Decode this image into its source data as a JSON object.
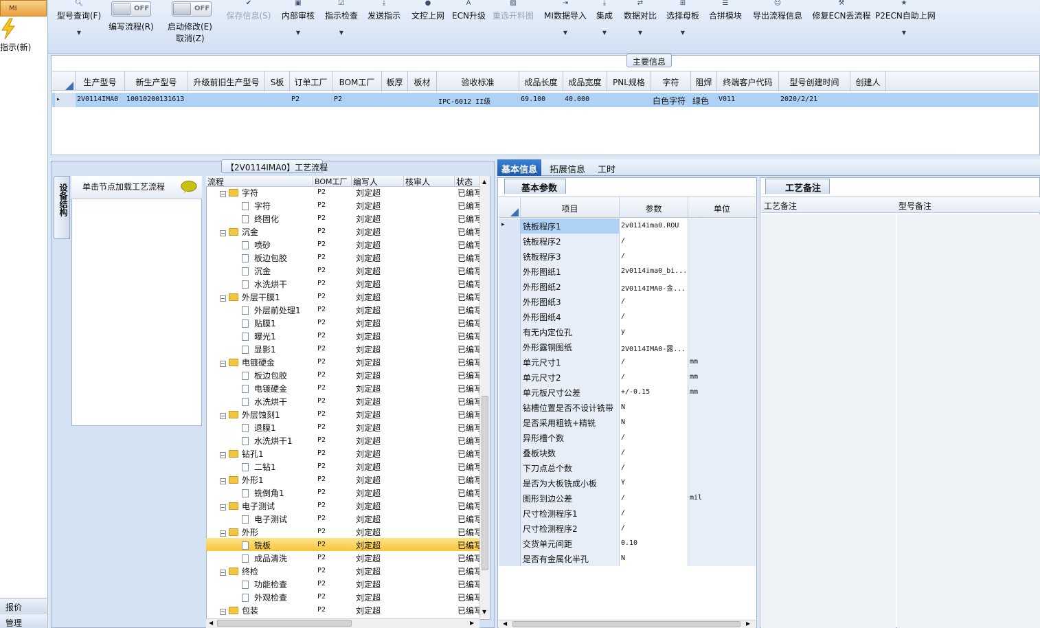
{
  "left_nav": {
    "module_tab": "MI",
    "current_item": "指示(新)",
    "bottom_items": [
      "报价",
      "管理"
    ]
  },
  "toolbar": {
    "query": "型号查询(F)",
    "edit_flow_toggle": "OFF",
    "edit_flow": "编写流程(R)",
    "start_modify_toggle": "OFF",
    "start_modify": "启动修改(E)",
    "cancel": "取消(Z)",
    "save_info": "保存信息(S)",
    "internal_audit": "内部审核",
    "instruction_check": "指示检查",
    "send_instruction": "发送指示",
    "doc_control_online": "文控上网",
    "ecn_upgrade": "ECN升级",
    "reselect_cut_chart": "重选开料图",
    "mi_import": "MI数据导入",
    "integrate": "集成",
    "data_compare": "数据对比",
    "select_mother_board": "选择母板",
    "merge_module": "合拼模块",
    "export_flow": "导出流程信息",
    "repair_ecn_flow": "修复ECN丢流程",
    "p2ecn_online": "P2ECN自助上网"
  },
  "main_info": {
    "title": "主要信息",
    "columns": [
      "生产型号",
      "新生产型号",
      "升级前旧生产型号",
      "S板",
      "订单工厂",
      "BOM工厂",
      "板厚",
      "板材",
      "验收标准",
      "成品长度",
      "成品宽度",
      "PNL规格",
      "字符",
      "阻焊",
      "终端客户代码",
      "型号创建时间",
      "创建人"
    ],
    "row": {
      "prod_model": "2V0114IMA0",
      "new_model": "10010200131613",
      "old_model": "",
      "s_board": "",
      "order_factory": "P2",
      "bom_factory": "P2",
      "thickness": "",
      "material": "",
      "standard": "IPC-6012 II级",
      "length": "69.100",
      "width": "40.000",
      "pnl": "",
      "silkscreen": "白色字符",
      "solder_mask": "绿色",
      "customer_code": "V011",
      "created": "2020/2/21",
      "creator": ""
    }
  },
  "process": {
    "title": "【2V0114IMA0】工艺流程",
    "side_tab": "设备结构",
    "node_hint": "单击节点加载工艺流程",
    "columns": [
      "流程",
      "BOM工厂",
      "编写人",
      "核审人",
      "状态"
    ],
    "rows": [
      {
        "name": "字符",
        "level": 0,
        "factory": "P2",
        "writer": "刘定超",
        "status": "已编写"
      },
      {
        "name": "字符",
        "level": 1,
        "factory": "P2",
        "writer": "刘定超",
        "status": "已编写"
      },
      {
        "name": "终固化",
        "level": 1,
        "factory": "P2",
        "writer": "刘定超",
        "status": "已编写"
      },
      {
        "name": "沉金",
        "level": 0,
        "factory": "P2",
        "writer": "刘定超",
        "status": "已编写"
      },
      {
        "name": "喷砂",
        "level": 1,
        "factory": "P2",
        "writer": "刘定超",
        "status": "已编写"
      },
      {
        "name": "板边包胶",
        "level": 1,
        "factory": "P2",
        "writer": "刘定超",
        "status": "已编写"
      },
      {
        "name": "沉金",
        "level": 1,
        "factory": "P2",
        "writer": "刘定超",
        "status": "已编写"
      },
      {
        "name": "水洗烘干",
        "level": 1,
        "factory": "P2",
        "writer": "刘定超",
        "status": "已编写"
      },
      {
        "name": "外层干膜1",
        "level": 0,
        "factory": "P2",
        "writer": "刘定超",
        "status": "已编写"
      },
      {
        "name": "外层前处理1",
        "level": 1,
        "factory": "P2",
        "writer": "刘定超",
        "status": "已编写"
      },
      {
        "name": "贴膜1",
        "level": 1,
        "factory": "P2",
        "writer": "刘定超",
        "status": "已编写"
      },
      {
        "name": "曝光1",
        "level": 1,
        "factory": "P2",
        "writer": "刘定超",
        "status": "已编写"
      },
      {
        "name": "显影1",
        "level": 1,
        "factory": "P2",
        "writer": "刘定超",
        "status": "已编写"
      },
      {
        "name": "电镀硬金",
        "level": 0,
        "factory": "P2",
        "writer": "刘定超",
        "status": "已编写"
      },
      {
        "name": "板边包胶",
        "level": 1,
        "factory": "P2",
        "writer": "刘定超",
        "status": "已编写"
      },
      {
        "name": "电镀硬金",
        "level": 1,
        "factory": "P2",
        "writer": "刘定超",
        "status": "已编写"
      },
      {
        "name": "水洗烘干",
        "level": 1,
        "factory": "P2",
        "writer": "刘定超",
        "status": "已编写"
      },
      {
        "name": "外层蚀刻1",
        "level": 0,
        "factory": "P2",
        "writer": "刘定超",
        "status": "已编写"
      },
      {
        "name": "退膜1",
        "level": 1,
        "factory": "P2",
        "writer": "刘定超",
        "status": "已编写"
      },
      {
        "name": "水洗烘干1",
        "level": 1,
        "factory": "P2",
        "writer": "刘定超",
        "status": "已编写"
      },
      {
        "name": "钻孔1",
        "level": 0,
        "factory": "P2",
        "writer": "刘定超",
        "status": "已编写"
      },
      {
        "name": "二钻1",
        "level": 1,
        "factory": "P2",
        "writer": "刘定超",
        "status": "已编写"
      },
      {
        "name": "外形1",
        "level": 0,
        "factory": "P2",
        "writer": "刘定超",
        "status": "已编写"
      },
      {
        "name": "铣倒角1",
        "level": 1,
        "factory": "P2",
        "writer": "刘定超",
        "status": "已编写"
      },
      {
        "name": "电子测试",
        "level": 0,
        "factory": "P2",
        "writer": "刘定超",
        "status": "已编写"
      },
      {
        "name": "电子测试",
        "level": 1,
        "factory": "P2",
        "writer": "刘定超",
        "status": "已编写"
      },
      {
        "name": "外形",
        "level": 0,
        "factory": "P2",
        "writer": "刘定超",
        "status": "已编写"
      },
      {
        "name": "铣板",
        "level": 1,
        "factory": "P2",
        "writer": "刘定超",
        "status": "已编写",
        "selected": true
      },
      {
        "name": "成品清洗",
        "level": 1,
        "factory": "P2",
        "writer": "刘定超",
        "status": "已编写"
      },
      {
        "name": "终检",
        "level": 0,
        "factory": "P2",
        "writer": "刘定超",
        "status": "已编写"
      },
      {
        "name": "功能检查",
        "level": 1,
        "factory": "P2",
        "writer": "刘定超",
        "status": "已编写"
      },
      {
        "name": "外观检查",
        "level": 1,
        "factory": "P2",
        "writer": "刘定超",
        "status": "已编写"
      },
      {
        "name": "包装",
        "level": 0,
        "factory": "P2",
        "writer": "刘定超",
        "status": "已编写"
      }
    ]
  },
  "detail_tabs": [
    "基本信息",
    "拓展信息",
    "工时"
  ],
  "basic": {
    "tab": "基本参数",
    "columns": [
      "项目",
      "参数",
      "单位"
    ],
    "rows": [
      {
        "k": "铣板程序1",
        "v": "2v0114ima0.ROU",
        "u": ""
      },
      {
        "k": "铣板程序2",
        "v": "/",
        "u": ""
      },
      {
        "k": "铣板程序3",
        "v": "/",
        "u": ""
      },
      {
        "k": "外形图纸1",
        "v": "2v0114ima0_bi...",
        "u": ""
      },
      {
        "k": "外形图纸2",
        "v": "2V0114IMA0-金...",
        "u": ""
      },
      {
        "k": "外形图纸3",
        "v": "/",
        "u": ""
      },
      {
        "k": "外形图纸4",
        "v": "/",
        "u": ""
      },
      {
        "k": "有无内定位孔",
        "v": "y",
        "u": ""
      },
      {
        "k": "外形露铜图纸",
        "v": "2V0114IMA0-露...",
        "u": ""
      },
      {
        "k": "单元尺寸1",
        "v": "/",
        "u": "mm"
      },
      {
        "k": "单元尺寸2",
        "v": "/",
        "u": "mm"
      },
      {
        "k": "单元板尺寸公差",
        "v": "+/-0.15",
        "u": "mm"
      },
      {
        "k": "钻槽位置是否不设计铣带",
        "v": "N",
        "u": ""
      },
      {
        "k": "是否采用粗铣+精铣",
        "v": "N",
        "u": ""
      },
      {
        "k": "异形槽个数",
        "v": "/",
        "u": ""
      },
      {
        "k": "叠板块数",
        "v": "/",
        "u": ""
      },
      {
        "k": "下刀点总个数",
        "v": "/",
        "u": ""
      },
      {
        "k": "是否为大板铣成小板",
        "v": "Y",
        "u": ""
      },
      {
        "k": "图形到边公差",
        "v": "/",
        "u": "mil"
      },
      {
        "k": "尺寸检测程序1",
        "v": "/",
        "u": ""
      },
      {
        "k": "尺寸检测程序2",
        "v": "/",
        "u": ""
      },
      {
        "k": "交货单元间距",
        "v": "0.10",
        "u": ""
      },
      {
        "k": "是否有金属化半孔",
        "v": "N",
        "u": ""
      }
    ]
  },
  "remarks": {
    "tab": "工艺备注",
    "col1": "工艺备注",
    "col2": "型号备注"
  }
}
